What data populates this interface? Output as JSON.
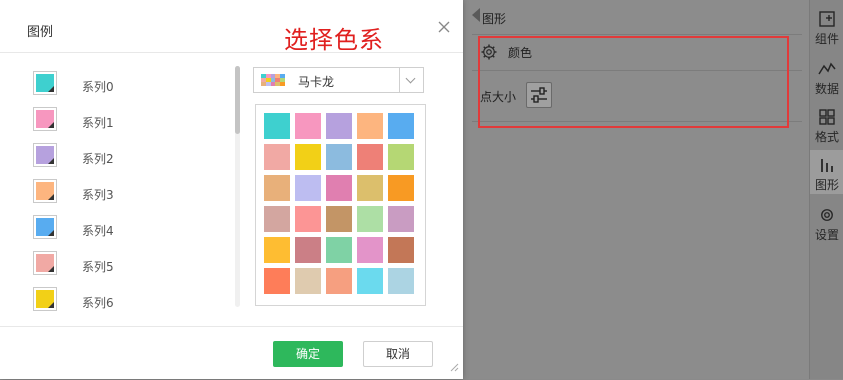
{
  "background_panel": {
    "header_title": "图形",
    "color_row_label": "颜色",
    "size_row_label": "点大小",
    "sidebar": [
      {
        "label": "组件",
        "icon": "add-component-icon"
      },
      {
        "label": "数据",
        "icon": "data-line-icon"
      },
      {
        "label": "格式",
        "icon": "grid-format-icon"
      },
      {
        "label": "图形",
        "icon": "bar-chart-icon",
        "active": true
      },
      {
        "label": "设置",
        "icon": "gear-icon"
      }
    ]
  },
  "annotation": "选择色系",
  "dialog": {
    "title": "图例",
    "series": [
      {
        "label": "系列0",
        "color": "#3ed0cf"
      },
      {
        "label": "系列1",
        "color": "#f797bf"
      },
      {
        "label": "系列2",
        "color": "#b6a1de"
      },
      {
        "label": "系列3",
        "color": "#fdb57f"
      },
      {
        "label": "系列4",
        "color": "#58acf0"
      },
      {
        "label": "系列5",
        "color": "#f1a9a4"
      },
      {
        "label": "系列6",
        "color": "#f2d017"
      }
    ],
    "palette_name": "马卡龙",
    "palette_colors": [
      "#3ed0cf",
      "#f797bf",
      "#b6a1de",
      "#fdb57f",
      "#58acf0",
      "#f1a9a4",
      "#f2d017",
      "#8cbbdf",
      "#ee8077",
      "#b5d774",
      "#e8b07a",
      "#bdbdf1",
      "#e07fb0",
      "#dcbf6c",
      "#f89a23",
      "#d3a6a0",
      "#fc9595",
      "#c39566",
      "#addfa5",
      "#c99cc2",
      "#febd32",
      "#cb7f86",
      "#7fd2a5",
      "#e394c9",
      "#c37757",
      "#fe7d59",
      "#dfcbaf",
      "#f69f80",
      "#6bdaee",
      "#acd4e3"
    ],
    "ok_label": "确定",
    "cancel_label": "取消"
  }
}
